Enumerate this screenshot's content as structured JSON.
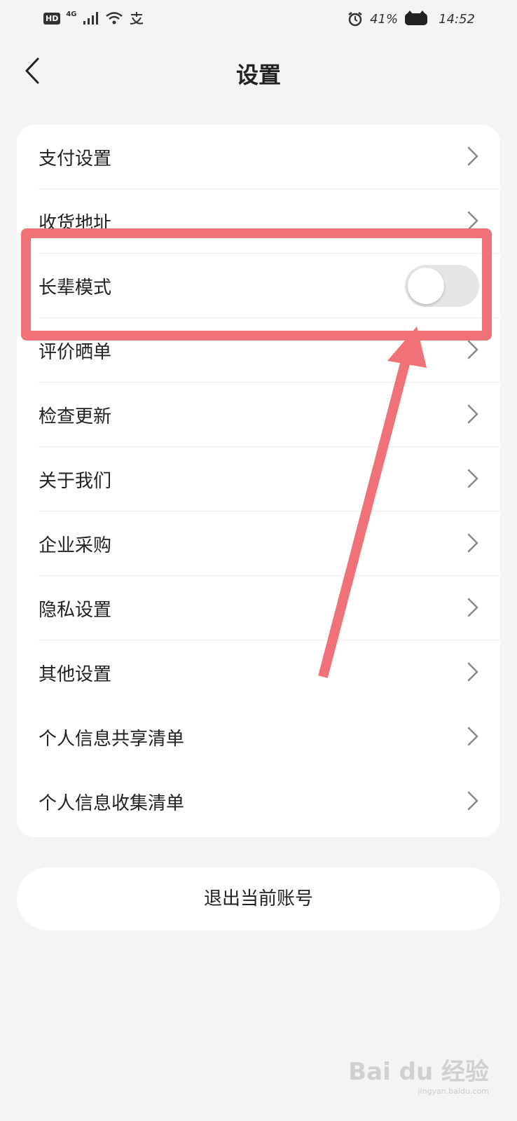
{
  "status_bar": {
    "hd": "HD",
    "network": "4G",
    "battery_percent": "41%",
    "time": "14:52"
  },
  "header": {
    "title": "设置",
    "back_icon": "chevron-left-icon"
  },
  "settings_items": [
    {
      "label": "支付设置",
      "type": "link"
    },
    {
      "label": "收货地址",
      "type": "link"
    },
    {
      "label": "长辈模式",
      "type": "toggle",
      "toggle_on": false
    },
    {
      "label": "评价晒单",
      "type": "link"
    },
    {
      "label": "检查更新",
      "type": "link"
    },
    {
      "label": "关于我们",
      "type": "link"
    },
    {
      "label": "企业采购",
      "type": "link"
    },
    {
      "label": "隐私设置",
      "type": "link"
    },
    {
      "label": "其他设置",
      "type": "link"
    },
    {
      "label": "个人信息共享清单",
      "type": "link"
    },
    {
      "label": "个人信息收集清单",
      "type": "link"
    }
  ],
  "logout_label": "退出当前账号",
  "watermark": {
    "logo": "Bai du 经验",
    "sub": "jingyan.baidu.com"
  },
  "colors": {
    "background": "#f4f4f4",
    "card": "#ffffff",
    "annotation": "#f07178",
    "toggle_off": "#e6e6e6"
  }
}
